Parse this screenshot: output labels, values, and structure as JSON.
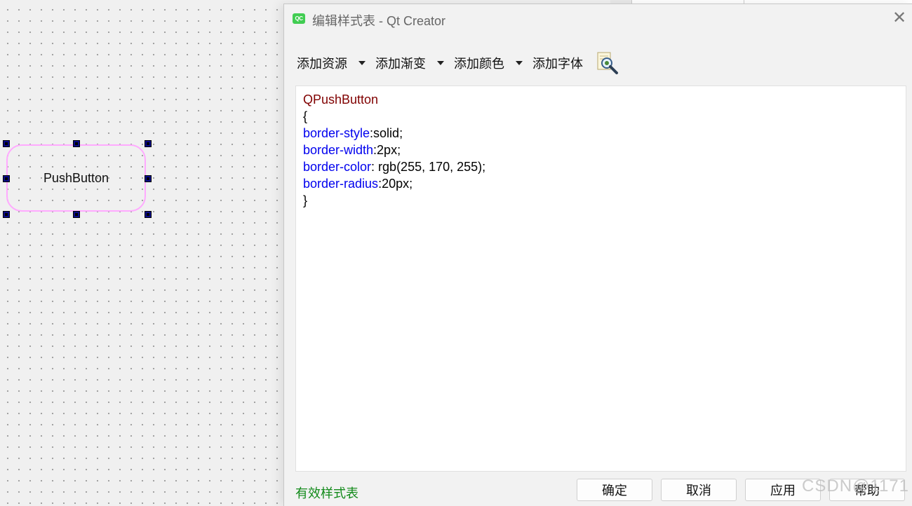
{
  "designer": {
    "button_text": "PushButton",
    "border_color": "#ffaaff"
  },
  "dialog": {
    "title": "编辑样式表 - Qt Creator",
    "logo_text": "QC",
    "close_icon": "close-icon",
    "toolbar": {
      "add_resource": "添加资源",
      "add_gradient": "添加渐变",
      "add_color": "添加颜色",
      "add_font": "添加字体",
      "search_icon": "magnifier-icon"
    },
    "editor": {
      "selector": "QPushButton",
      "open_brace": "{",
      "close_brace": "}",
      "properties": [
        {
          "name": "border-style",
          "rest": ":solid;"
        },
        {
          "name": "border-width",
          "rest": ":2px;"
        },
        {
          "name": "border-color",
          "rest": ": rgb(255, 170, 255);"
        },
        {
          "name": "border-radius",
          "rest": ":20px;"
        }
      ]
    },
    "footer": {
      "status": "有效样式表",
      "ok": "确定",
      "cancel": "取消",
      "apply": "应用",
      "help": "帮助"
    }
  },
  "watermark": "CSDN@1171",
  "colors": {
    "selector": "#800000",
    "property": "#0000ee",
    "valid_status": "#128a1a"
  }
}
